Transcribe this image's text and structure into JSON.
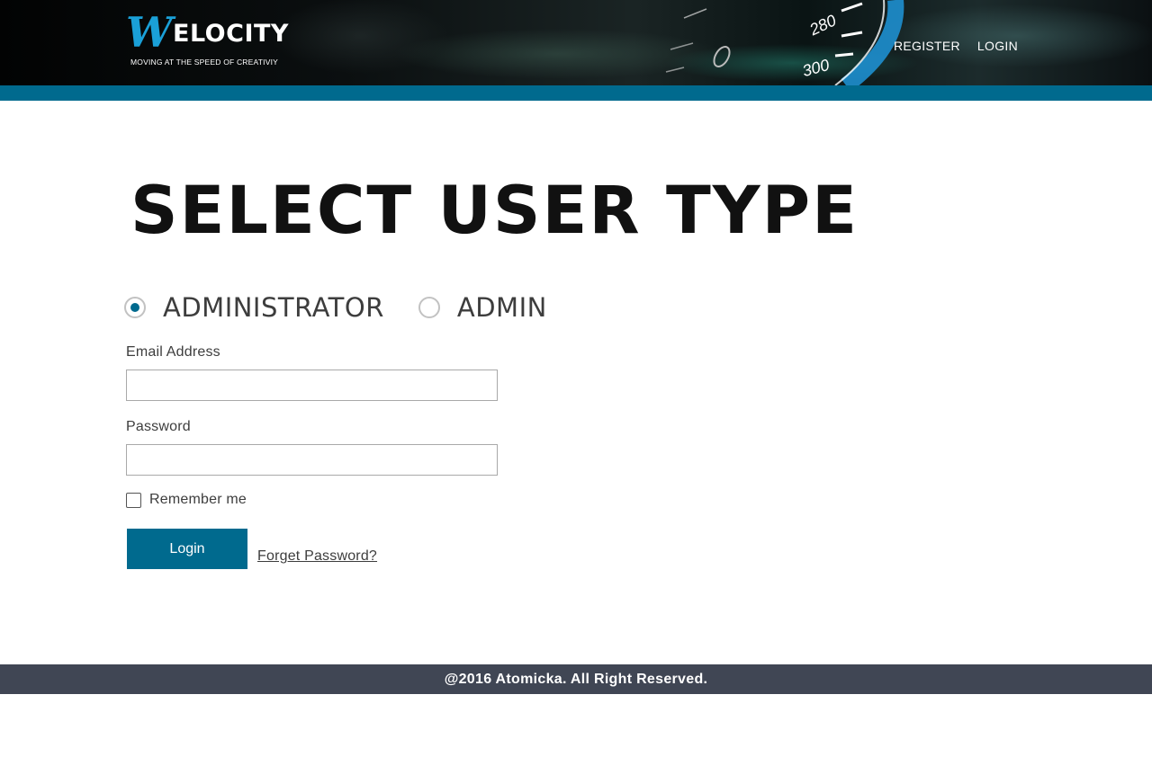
{
  "header": {
    "logo_letter": "W",
    "logo_text": "ELOCITY",
    "logo_tagline": "MOVING AT THE SPEED OF CREATIVIY",
    "speedometer_labels": [
      "280",
      "300"
    ],
    "nav": [
      {
        "label": "REGISTER"
      },
      {
        "label": "LOGIN"
      }
    ]
  },
  "main": {
    "title": "SELECT USER TYPE",
    "user_types": [
      {
        "label": "ADMINISTRATOR",
        "selected": true
      },
      {
        "label": "ADMIN",
        "selected": false
      }
    ],
    "email": {
      "label": "Email Address",
      "value": "",
      "placeholder": ""
    },
    "password": {
      "label": "Password",
      "value": "",
      "placeholder": ""
    },
    "remember": {
      "label": "Remember me",
      "checked": false
    },
    "login_button": "Login",
    "forget_link": "Forget Password?"
  },
  "footer": {
    "text": "@2016 Atomicka. All Right Reserved."
  },
  "colors": {
    "accent": "#006a8e",
    "logo_blue": "#1aa0d8",
    "footer_bg": "#404654",
    "header_bg": "#050607"
  },
  "icons": [
    "radio-selected",
    "radio-unselected",
    "checkbox-unchecked"
  ]
}
